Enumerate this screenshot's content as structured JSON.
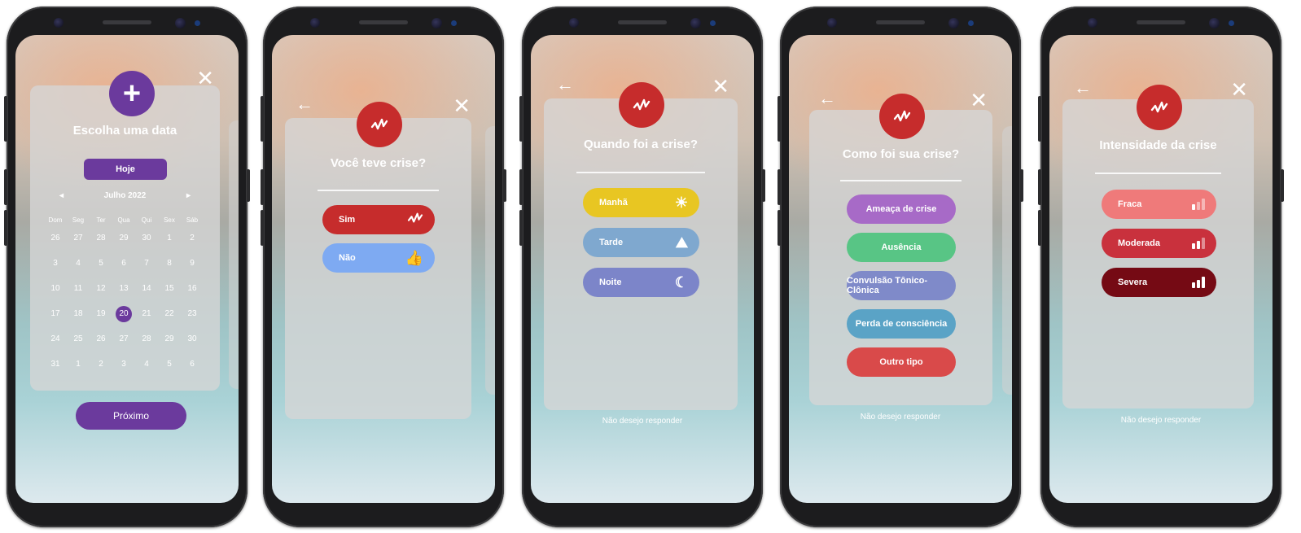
{
  "screen1": {
    "title": "Escolha uma data",
    "today_label": "Hoje",
    "month_label": "Julho 2022",
    "weekdays": [
      "Dom",
      "Seg",
      "Ter",
      "Qua",
      "Qui",
      "Sex",
      "Sáb"
    ],
    "days": [
      [
        "26",
        "27",
        "28",
        "29",
        "30",
        "1",
        "2"
      ],
      [
        "3",
        "4",
        "5",
        "6",
        "7",
        "8",
        "9"
      ],
      [
        "10",
        "11",
        "12",
        "13",
        "14",
        "15",
        "16"
      ],
      [
        "17",
        "18",
        "19",
        "20",
        "21",
        "22",
        "23"
      ],
      [
        "24",
        "25",
        "26",
        "27",
        "28",
        "29",
        "30"
      ],
      [
        "31",
        "1",
        "2",
        "3",
        "4",
        "5",
        "6"
      ]
    ],
    "selected_day": "20",
    "next_label": "Próximo",
    "prev_glyph": "◂",
    "next_glyph": "▸",
    "plus_glyph": "+",
    "close_glyph": "✕"
  },
  "screen2": {
    "title": "Você teve crise?",
    "options": [
      {
        "label": "Sim",
        "color": "#c62c2c",
        "icon": "seizure-wave-icon"
      },
      {
        "label": "Não",
        "color": "#7eaaf2",
        "icon": "thumbs-up-icon"
      }
    ],
    "back_glyph": "←",
    "close_glyph": "✕",
    "thumbs_glyph": "👍"
  },
  "screen3": {
    "title": "Quando foi a crise?",
    "options": [
      {
        "label": "Manhã",
        "color": "#e8c622",
        "icon": "sun-icon"
      },
      {
        "label": "Tarde",
        "color": "#7fa8cf",
        "icon": "mountain-sun-icon"
      },
      {
        "label": "Noite",
        "color": "#7c85c9",
        "icon": "moon-icon"
      }
    ],
    "skip_label": "Não desejo responder",
    "back_glyph": "←",
    "close_glyph": "✕",
    "sun_glyph": "☀",
    "mountain_glyph": "⛰",
    "moon_glyph": "☾"
  },
  "screen4": {
    "title": "Como foi sua crise?",
    "options": [
      {
        "label": "Ameaça de crise",
        "color": "#a76ac7"
      },
      {
        "label": "Ausência",
        "color": "#58c585"
      },
      {
        "label": "Convulsão Tônico-Clônica",
        "color": "#7f8ac9"
      },
      {
        "label": "Perda de consciência",
        "color": "#5aa3c6"
      },
      {
        "label": "Outro tipo",
        "color": "#d94a4a"
      }
    ],
    "skip_label": "Não desejo responder",
    "back_glyph": "←",
    "close_glyph": "✕"
  },
  "screen5": {
    "title": "Intensidade da crise",
    "options": [
      {
        "label": "Fraca",
        "color": "#ef7a7a",
        "level": 1
      },
      {
        "label": "Moderada",
        "color": "#c9313d",
        "level": 2
      },
      {
        "label": "Severa",
        "color": "#750a14",
        "level": 3
      }
    ],
    "skip_label": "Não desejo responder",
    "back_glyph": "←",
    "close_glyph": "✕"
  }
}
